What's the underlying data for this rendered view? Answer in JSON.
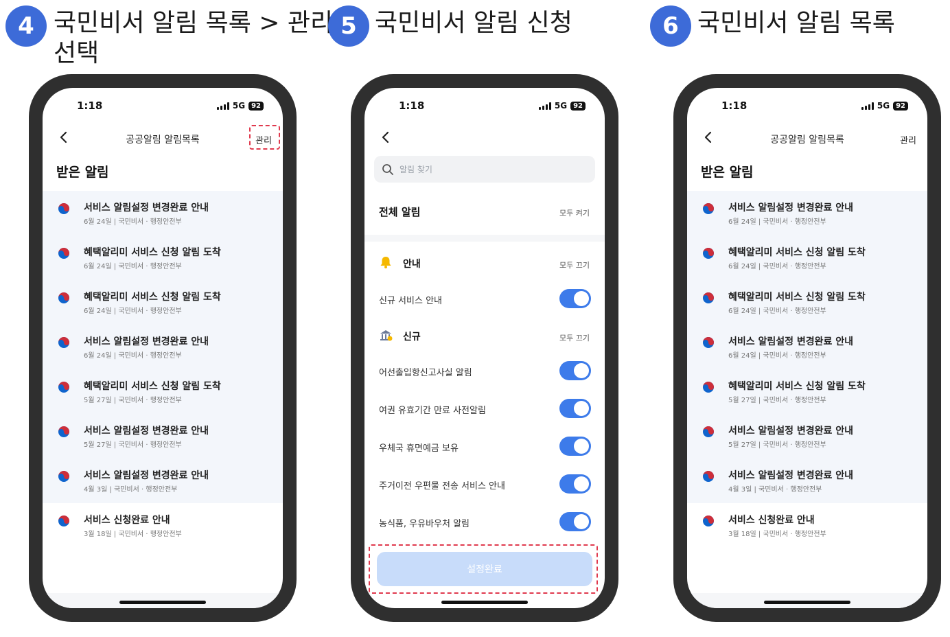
{
  "steps": [
    {
      "number": "4",
      "title_line1": "국민비서 알림 목록 > 관리",
      "title_line2": "선택"
    },
    {
      "number": "5",
      "title_line1": "국민비서 알림 신청"
    },
    {
      "number": "6",
      "title_line1": "국민비서 알림 목록"
    }
  ],
  "status": {
    "time": "1:18",
    "network": "5G",
    "battery": "92"
  },
  "list_screen": {
    "nav_title": "공공알림 알림목록",
    "manage_label": "관리",
    "section_header": "받은 알림",
    "items": [
      {
        "title": "서비스 알림설정 변경완료 안내",
        "meta": "6월 24일 | 국민비서 · 행정안전부",
        "state": "read"
      },
      {
        "title": "혜택알리미 서비스 신청 알림 도착",
        "meta": "6월 24일 | 국민비서 · 행정안전부",
        "state": "read"
      },
      {
        "title": "혜택알리미 서비스 신청 알림 도착",
        "meta": "6월 24일 | 국민비서 · 행정안전부",
        "state": "read"
      },
      {
        "title": "서비스 알림설정 변경완료 안내",
        "meta": "6월 24일 | 국민비서 · 행정안전부",
        "state": "read"
      },
      {
        "title": "혜택알리미 서비스 신청 알림 도착",
        "meta": "5월 27일 | 국민비서 · 행정안전부",
        "state": "read"
      },
      {
        "title": "서비스 알림설정 변경완료 안내",
        "meta": "5월 27일 | 국민비서 · 행정안전부",
        "state": "read"
      },
      {
        "title": "서비스 알림설정 변경완료 안내",
        "meta": "4월 3일 | 국민비서 · 행정안전부",
        "state": "read"
      },
      {
        "title": "서비스 신청완료 안내",
        "meta": "3월 18일 | 국민비서 · 행정안전부",
        "state": "unread"
      }
    ]
  },
  "settings_screen": {
    "search_placeholder": "알림 찾기",
    "all_label": "전체 알림",
    "all_action": "모두 켜기",
    "category_info": {
      "label": "안내",
      "action": "모두 끄기",
      "icon": "bell-icon"
    },
    "info_items": [
      {
        "label": "신규 서비스 안내",
        "on": true
      }
    ],
    "category_new": {
      "label": "신규",
      "action": "모두 끄기",
      "icon": "building-icon"
    },
    "new_items": [
      {
        "label": "어선출입항신고사실 알림",
        "on": true
      },
      {
        "label": "여권 유효기간 만료 사전알림",
        "on": true
      },
      {
        "label": "우체국 휴면예금 보유",
        "on": true
      },
      {
        "label": "주거이전 우편물 전송 서비스 안내",
        "on": true
      },
      {
        "label": "농식품, 우유바우처 알림",
        "on": true
      }
    ],
    "complete_button": "설정완료"
  },
  "colors": {
    "accent": "#3d6bd8",
    "toggle_on": "#3d7bea",
    "highlight": "#e0394d",
    "read_bg": "#f3f6fb"
  }
}
